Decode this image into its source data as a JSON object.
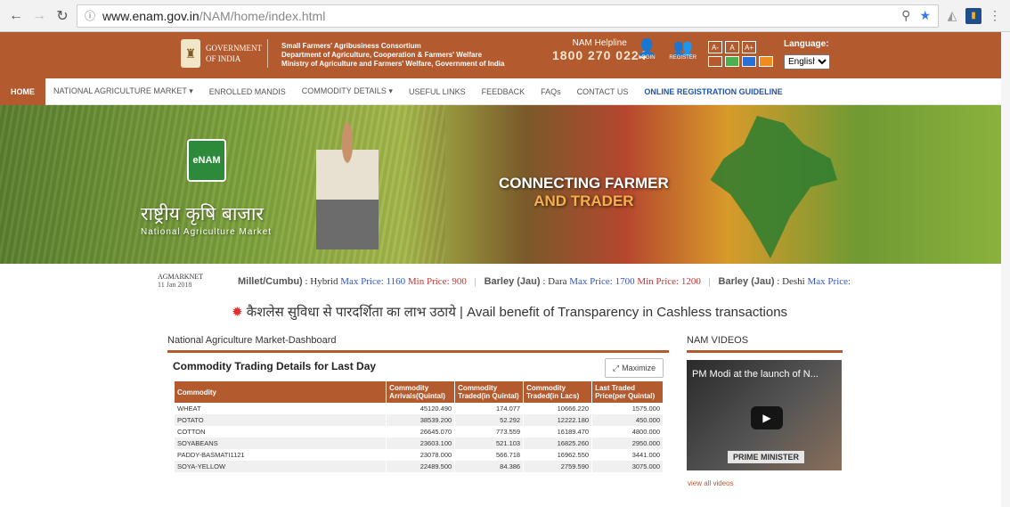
{
  "browser": {
    "url_host": "www.enam.gov.in",
    "url_path": "/NAM/home/index.html"
  },
  "header": {
    "gov_line1": "GOVERNMENT",
    "gov_line2": "OF INDIA",
    "sfac_line1": "Small Farmers' Agribusiness Consortium",
    "sfac_line2": "Department of Agriculture, Cooperation & Farmers' Welfare",
    "sfac_line3": "Ministry of Agriculture and Farmers' Welfare, Government of India",
    "helpline_label": "NAM Helpline",
    "helpline_number": "1800 270 0224",
    "login_label": "LOGIN",
    "register_label": "REGISTER",
    "font_small": "A-",
    "font_normal": "A",
    "font_large": "A+",
    "language_label": "Language:",
    "language_value": "English"
  },
  "nav": {
    "home": "HOME",
    "national_market": "NATIONAL AGRICULTURE MARKET ▾",
    "enrolled_mandis": "ENROLLED MANDIS",
    "commodity_details": "COMMODITY DETAILS ▾",
    "useful_links": "USEFUL LINKS",
    "feedback": "FEEDBACK",
    "faqs": "FAQs",
    "contact_us": "CONTACT US",
    "online_registration": "ONLINE REGISTRATION GUIDELINE"
  },
  "banner": {
    "logo_text": "eNAM",
    "hindi_title": "राष्ट्रीय कृषि बाजार",
    "english_title": "National Agriculture Market",
    "connecting_line1": "CONNECTING FARMER",
    "connecting_line2": "AND TRADER"
  },
  "ticker": {
    "source": "AGMARKNET",
    "date": "11 Jan 2018",
    "items": [
      {
        "commodity": "Millet/Cumbu)",
        "variety": ": Hybrid",
        "max": "Max Price: 1160",
        "min": "Min Price: 900"
      },
      {
        "commodity": "Barley (Jau)",
        "variety": ": Dara",
        "max": "Max Price: 1700",
        "min": "Min Price: 1200"
      },
      {
        "commodity": "Barley (Jau)",
        "variety": ": Deshi",
        "max": "Max Price:",
        "min": ""
      }
    ]
  },
  "cashless": "कैशलेस सुविधा से पारदर्शिता का लाभ उठाये | Avail benefit of Transparency in Cashless transactions",
  "dashboard": {
    "title": "National Agriculture Market-Dashboard",
    "card_title": "Commodity Trading Details for Last Day",
    "maximize": "Maximize",
    "columns": [
      "Commodity",
      "Commodity Arrivals(Quintal)",
      "Commodity Traded(in Quintal)",
      "Commodity Traded(in Lacs)",
      "Last Traded Price(per Quintal)"
    ],
    "rows": [
      [
        "WHEAT",
        "45120.490",
        "174.077",
        "10666.220",
        "1575.000"
      ],
      [
        "POTATO",
        "38539.200",
        "52.292",
        "12222.180",
        "450.000"
      ],
      [
        "COTTON",
        "26645.070",
        "773.559",
        "16189.470",
        "4800.000"
      ],
      [
        "SOYABEANS",
        "23603.100",
        "521.103",
        "16825.260",
        "2950.000"
      ],
      [
        "PADDY-BASMATI1121",
        "23078.000",
        "566.718",
        "16962.550",
        "3441.000"
      ],
      [
        "SOYA-YELLOW",
        "22489.500",
        "84.386",
        "2759.590",
        "3075.000"
      ]
    ]
  },
  "videos": {
    "title": "NAM VIDEOS",
    "video_title": "PM Modi at the launch of N...",
    "caption": "PRIME MINISTER",
    "view_all": "view all videos"
  }
}
